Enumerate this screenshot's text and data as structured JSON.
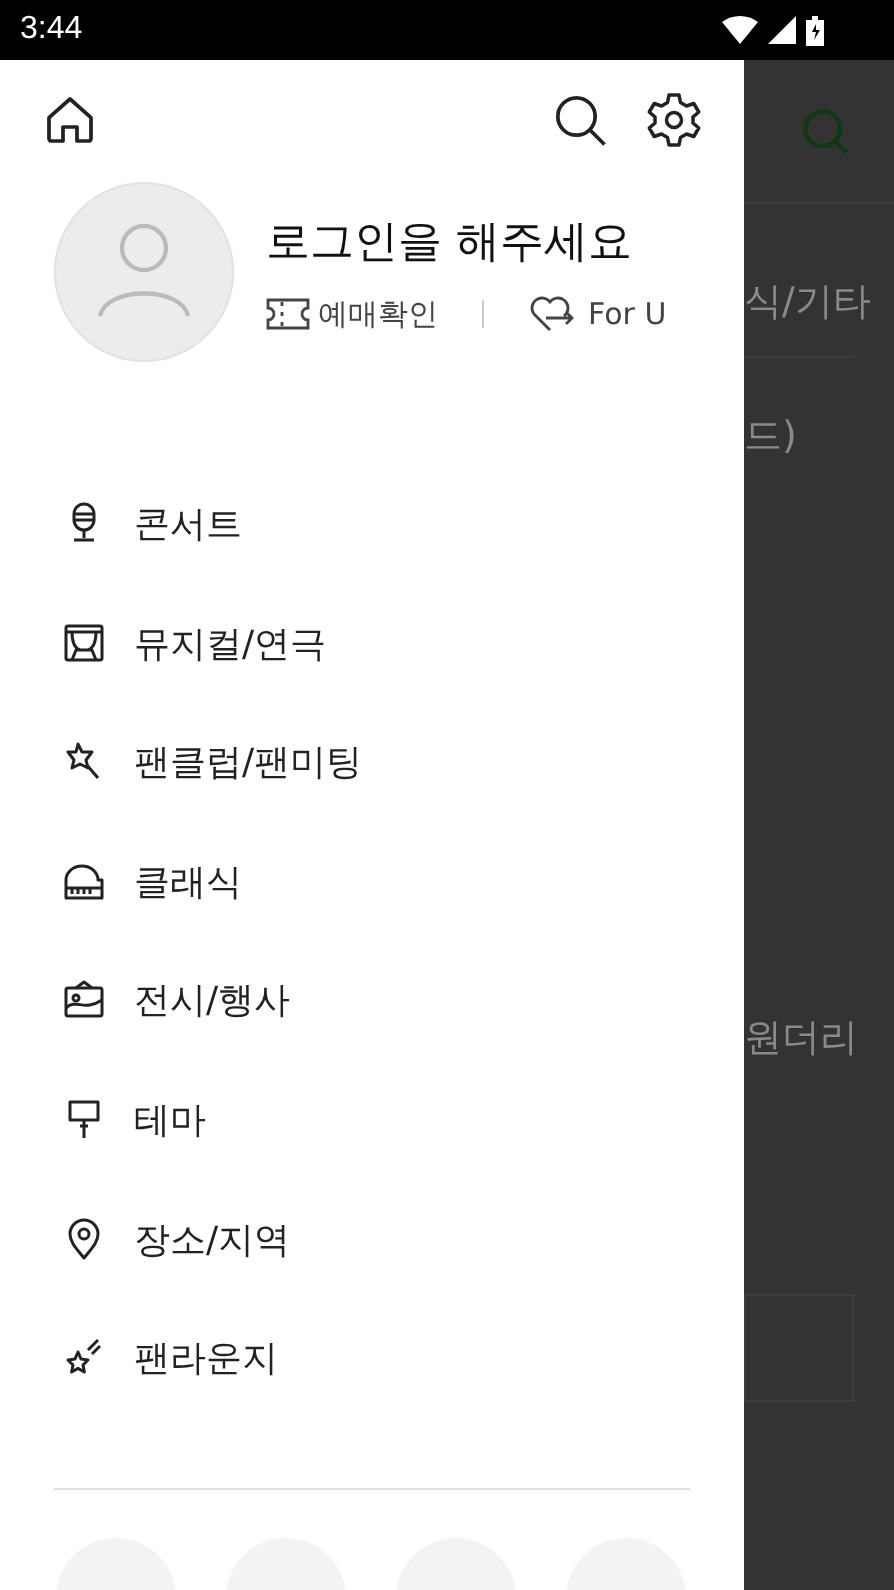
{
  "status_bar": {
    "time": "3:44"
  },
  "drawer": {
    "profile": {
      "title": "로그인을 해주세요",
      "links": [
        "예매확인",
        "For U"
      ]
    },
    "menu": [
      {
        "label": "콘서트"
      },
      {
        "label": "뮤지컬/연극"
      },
      {
        "label": "팬클럽/팬미팅"
      },
      {
        "label": "클래식"
      },
      {
        "label": "전시/행사"
      },
      {
        "label": "테마"
      },
      {
        "label": "장소/지역"
      },
      {
        "label": "팬라운지"
      }
    ]
  },
  "background_page": {
    "texts": [
      "식/기타",
      "드)",
      "원더리"
    ]
  }
}
